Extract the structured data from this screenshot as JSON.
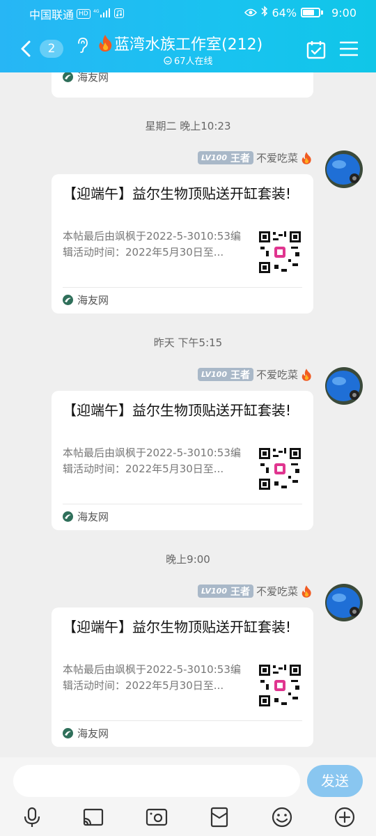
{
  "status_bar": {
    "carrier": "中国联通",
    "hd": "HD",
    "network": "4G",
    "battery": "64%",
    "time": "9:00"
  },
  "header": {
    "unread": "2",
    "title": "蓝湾水族工作室(212)",
    "online": "67人在线"
  },
  "partial_card": {
    "source": "海友网"
  },
  "messages": [
    {
      "time": "星期二 晚上10:23",
      "level": "LV100",
      "rank": "王者",
      "sender": "不爱吃菜",
      "card": {
        "title": "【迎端午】益尔生物顶贴送开缸套装!",
        "desc": "本帖最后由飒枫于2022-5-3010:53编辑活动时间：2022年5月30日至...",
        "source": "海友网"
      }
    },
    {
      "time": "昨天 下午5:15",
      "level": "LV100",
      "rank": "王者",
      "sender": "不爱吃菜",
      "card": {
        "title": "【迎端午】益尔生物顶贴送开缸套装!",
        "desc": "本帖最后由飒枫于2022-5-3010:53编辑活动时间：2022年5月30日至...",
        "source": "海友网"
      }
    },
    {
      "time": "晚上9:00",
      "level": "LV100",
      "rank": "王者",
      "sender": "不爱吃菜",
      "card": {
        "title": "【迎端午】益尔生物顶贴送开缸套装!",
        "desc": "本帖最后由飒枫于2022-5-3010:53编辑活动时间：2022年5月30日至...",
        "source": "海友网"
      }
    }
  ],
  "input": {
    "value": "",
    "send_label": "发送"
  },
  "toolbar_icons": [
    "microphone-icon",
    "screen-share-icon",
    "photo-icon",
    "red-packet-icon",
    "emoji-icon",
    "plus-icon"
  ],
  "colors": {
    "header_start": "#27b6f5",
    "header_end": "#10c6e8",
    "send": "#89c6f0",
    "badge": "#a9b8c8"
  }
}
